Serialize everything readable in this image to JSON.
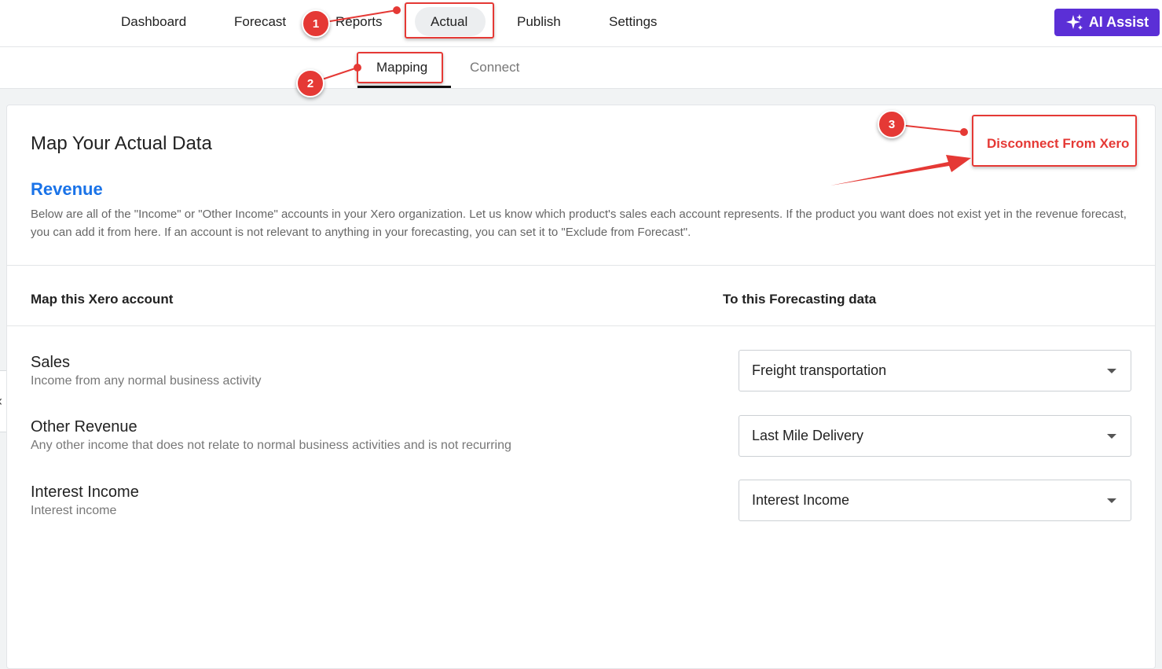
{
  "top_nav": {
    "items": [
      {
        "label": "Dashboard"
      },
      {
        "label": "Forecast"
      },
      {
        "label": "Reports"
      },
      {
        "label": "Actual"
      },
      {
        "label": "Publish"
      },
      {
        "label": "Settings"
      }
    ],
    "active": "Actual",
    "ai_button": {
      "label": "AI Assist",
      "icon": "sparkles-icon"
    }
  },
  "sub_nav": {
    "items": [
      {
        "label": "Mapping"
      },
      {
        "label": "Connect"
      }
    ],
    "active": "Mapping"
  },
  "main": {
    "title": "Map Your Actual Data",
    "disconnect_label": "Disconnect From Xero",
    "section_title": "Revenue",
    "description": "Below are all of the \"Income\" or \"Other Income\" accounts in your Xero organization. Let us know which product's sales each account represents. If the product you want does not exist yet in the revenue forecast, you can add it from here. If an account is not relevant to anything in your forecasting, you can set it to \"Exclude from Forecast\".",
    "column_headers": {
      "left": "Map this Xero account",
      "right": "To this Forecasting data"
    },
    "rows": [
      {
        "title": "Sales",
        "subtitle": "Income from any normal business activity",
        "selected": "Freight transportation"
      },
      {
        "title": "Other Revenue",
        "subtitle": "Any other income that does not relate to normal business activities and is not recurring",
        "selected": "Last Mile Delivery"
      },
      {
        "title": "Interest Income",
        "subtitle": "Interest income",
        "selected": "Interest Income"
      }
    ]
  },
  "annotations": {
    "badges": [
      "1",
      "2",
      "3"
    ],
    "color": "#e53935"
  },
  "colors": {
    "accent_purple": "#5b2fd6",
    "link_blue": "#1a73e8",
    "danger_red": "#e53935"
  }
}
